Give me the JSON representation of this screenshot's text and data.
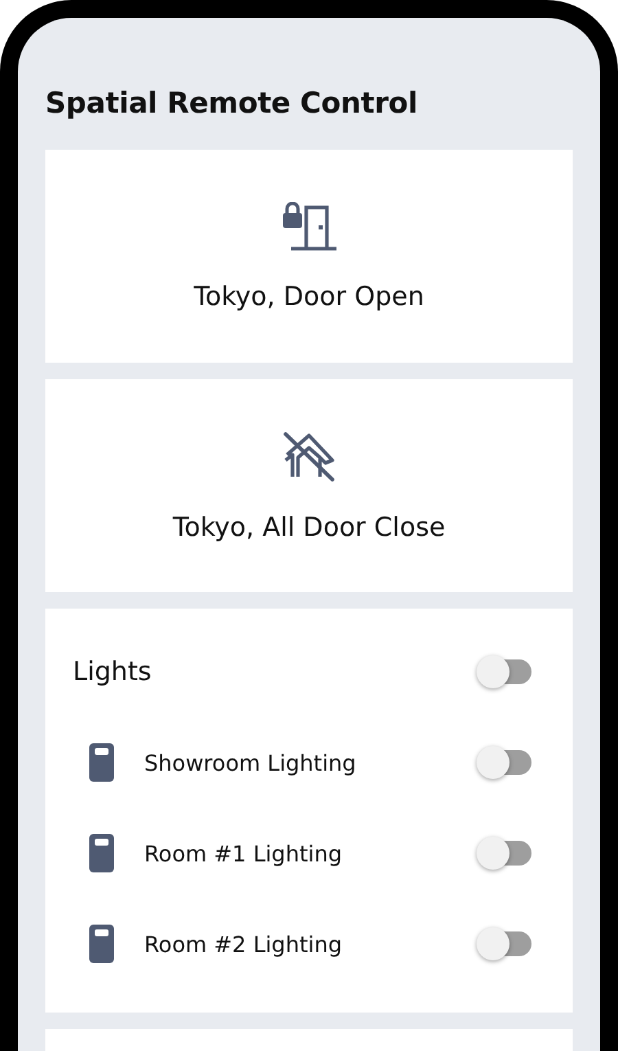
{
  "title": "Spatial Remote Control",
  "actions": [
    {
      "label": "Tokyo, Door Open",
      "kind": "door"
    },
    {
      "label": "Tokyo, All Door Close",
      "kind": "house"
    }
  ],
  "lights": {
    "label": "Lights",
    "on": false,
    "items": [
      {
        "label": "Showroom Lighting",
        "on": false
      },
      {
        "label": "Room #1 Lighting",
        "on": false
      },
      {
        "label": "Room #2 Lighting",
        "on": false
      }
    ]
  }
}
